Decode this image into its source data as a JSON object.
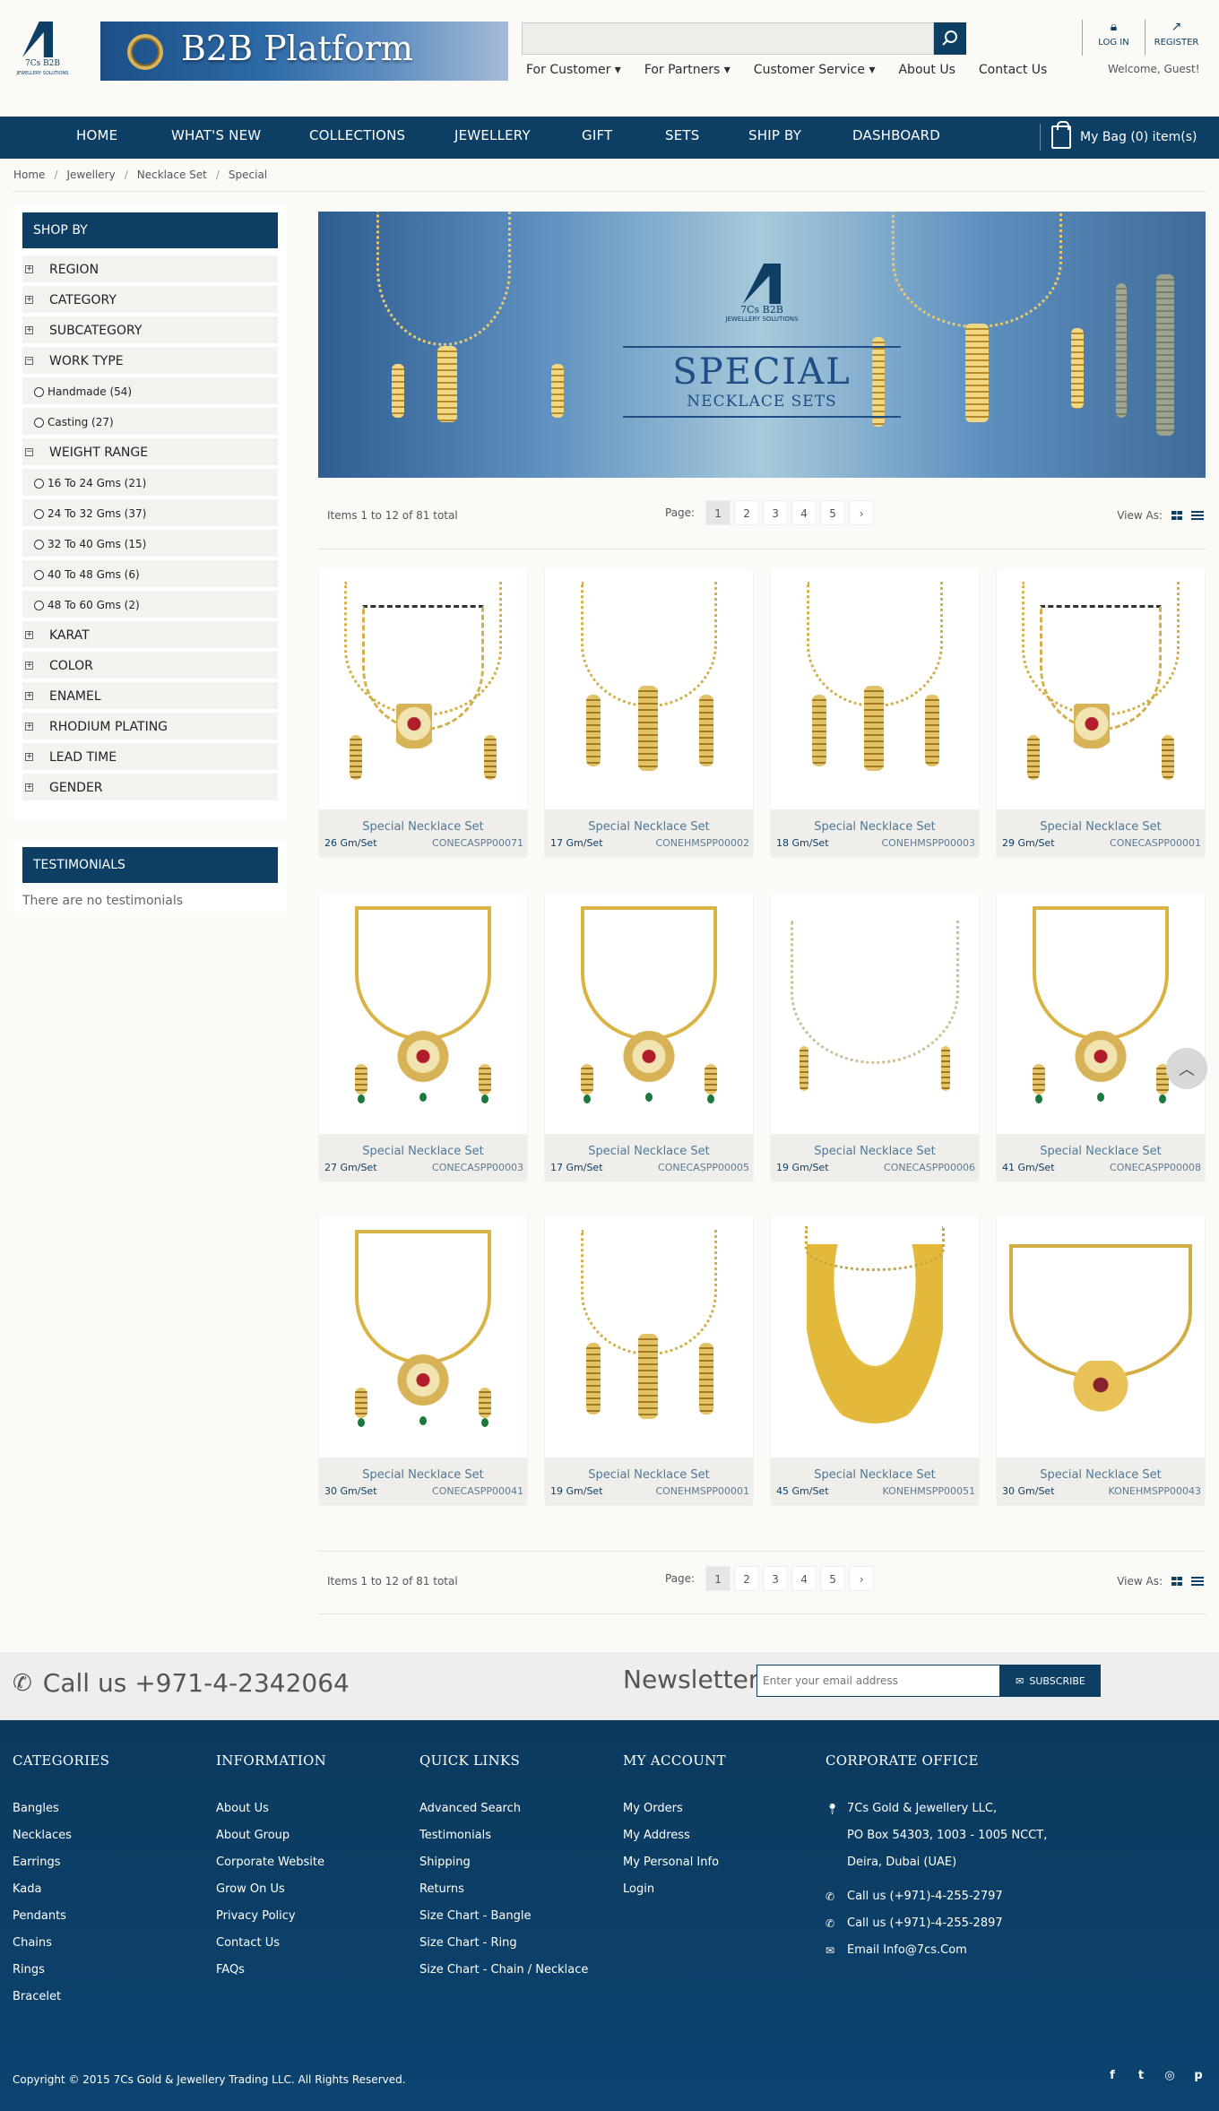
{
  "header": {
    "logo_text": "7Cs B2B",
    "logo_sub": "JEWELLERY SOLUTIONS",
    "banner_text": "B2B Platform",
    "search_placeholder": "",
    "top_links": [
      "For Customer ▾",
      "For Partners ▾",
      "Customer Service ▾",
      "About Us",
      "Contact Us"
    ],
    "login_label": "LOG IN",
    "register_label": "REGISTER",
    "welcome": "Welcome, Guest!"
  },
  "nav": {
    "items": [
      "HOME",
      "WHAT'S NEW",
      "COLLECTIONS",
      "JEWELLERY",
      "GIFT",
      "SETS",
      "SHIP BY",
      "DASHBOARD"
    ],
    "bag": "My Bag (0) item(s)"
  },
  "breadcrumb": [
    "Home",
    "Jewellery",
    "Necklace Set",
    "Special"
  ],
  "sidebar": {
    "title": "SHOP BY",
    "rows": [
      {
        "type": "group",
        "label": "REGION",
        "sign": "+"
      },
      {
        "type": "group",
        "label": "CATEGORY",
        "sign": "+"
      },
      {
        "type": "group",
        "label": "SUBCATEGORY",
        "sign": "+"
      },
      {
        "type": "group",
        "label": "WORK TYPE",
        "sign": "−"
      },
      {
        "type": "option",
        "label": "Handmade (54)"
      },
      {
        "type": "option",
        "label": "Casting (27)"
      },
      {
        "type": "group",
        "label": "WEIGHT RANGE",
        "sign": "−"
      },
      {
        "type": "option",
        "label": "16 To 24 Gms (21)"
      },
      {
        "type": "option",
        "label": "24 To 32 Gms (37)"
      },
      {
        "type": "option",
        "label": "32 To 40 Gms (15)"
      },
      {
        "type": "option",
        "label": "40 To 48 Gms (6)"
      },
      {
        "type": "option",
        "label": "48 To 60 Gms (2)"
      },
      {
        "type": "group",
        "label": "KARAT",
        "sign": "+"
      },
      {
        "type": "group",
        "label": "COLOR",
        "sign": "+"
      },
      {
        "type": "group",
        "label": "ENAMEL",
        "sign": "+"
      },
      {
        "type": "group",
        "label": "RHODIUM PLATING",
        "sign": "+"
      },
      {
        "type": "group",
        "label": "LEAD TIME",
        "sign": "+"
      },
      {
        "type": "group",
        "label": "GENDER",
        "sign": "+"
      }
    ]
  },
  "testimonials": {
    "title": "TESTIMONIALS",
    "empty": "There are no testimonials"
  },
  "hero": {
    "logo_text": "7Cs B2B",
    "logo_sub": "JEWELLERY SOLUTIONS",
    "title": "SPECIAL",
    "subtitle": "NECKLACE SETS"
  },
  "toolbar": {
    "items_text": "Items 1 to 12 of 81 total",
    "page_label": "Page:",
    "pages": [
      "1",
      "2",
      "3",
      "4",
      "5"
    ],
    "current_page": "1",
    "next": "›",
    "view_as": "View As:"
  },
  "products": [
    {
      "name": "Special Necklace Set",
      "weight": "26 Gm/Set",
      "sku": "CONECASPP00071",
      "style": "double"
    },
    {
      "name": "Special Necklace Set",
      "weight": "17 Gm/Set",
      "sku": "CONEHMSPP00002",
      "style": "vchain"
    },
    {
      "name": "Special Necklace Set",
      "weight": "18 Gm/Set",
      "sku": "CONEHMSPP00003",
      "style": "vchain"
    },
    {
      "name": "Special Necklace Set",
      "weight": "29 Gm/Set",
      "sku": "CONECASPP00001",
      "style": "double"
    },
    {
      "name": "Special Necklace Set",
      "weight": "27 Gm/Set",
      "sku": "CONECASPP00003",
      "style": "pendant"
    },
    {
      "name": "Special Necklace Set",
      "weight": "17 Gm/Set",
      "sku": "CONECASPP00005",
      "style": "pendant"
    },
    {
      "name": "Special Necklace Set",
      "weight": "19 Gm/Set",
      "sku": "CONECASPP00006",
      "style": "stone"
    },
    {
      "name": "Special Necklace Set",
      "weight": "41 Gm/Set",
      "sku": "CONECASPP00008",
      "style": "pendant"
    },
    {
      "name": "Special Necklace Set",
      "weight": "30 Gm/Set",
      "sku": "CONECASPP00041",
      "style": "pendant"
    },
    {
      "name": "Special Necklace Set",
      "weight": "19 Gm/Set",
      "sku": "CONEHMSPP00001",
      "style": "vchain"
    },
    {
      "name": "Special Necklace Set",
      "weight": "45 Gm/Set",
      "sku": "KONEHMSPP00051",
      "style": "collar"
    },
    {
      "name": "Special Necklace Set",
      "weight": "30 Gm/Set",
      "sku": "KONEHMSPP00043",
      "style": "collar2"
    }
  ],
  "callbar": {
    "phone": "Call us +971-4-2342064",
    "newsletter_label": "Newsletter",
    "email_placeholder": "Enter your email address",
    "subscribe": "SUBSCRIBE"
  },
  "footer": {
    "categories": {
      "title": "CATEGORIES",
      "links": [
        "Bangles",
        "Necklaces",
        "Earrings",
        "Kada",
        "Pendants",
        "Chains",
        "Rings",
        "Bracelet"
      ]
    },
    "information": {
      "title": "INFORMATION",
      "links": [
        "About Us",
        "About Group",
        "Corporate Website",
        "Grow On Us",
        "Privacy Policy",
        "Contact Us",
        "FAQs"
      ]
    },
    "quick_links": {
      "title": "QUICK LINKS",
      "links": [
        "Advanced Search",
        "Testimonials",
        "Shipping",
        "Returns",
        "Size Chart - Bangle",
        "Size Chart - Ring",
        "Size Chart - Chain / Necklace"
      ]
    },
    "my_account": {
      "title": "MY ACCOUNT",
      "links": [
        "My Orders",
        "My Address",
        "My Personal Info",
        "Login"
      ]
    },
    "corporate": {
      "title": "CORPORATE OFFICE",
      "address1": "7Cs Gold & Jewellery LLC,",
      "address2": "PO Box 54303, 1003 - 1005 NCCT,",
      "address3": "Deira, Dubai (UAE)",
      "phone1": "Call us (+971)-4-255-2797",
      "phone2": "Call us (+971)-4-255-2897",
      "email": "Email Info@7cs.Com"
    },
    "copyright": "Copyright © 2015 7Cs Gold & Jewellery Trading LLC. All Rights Reserved."
  },
  "colors": {
    "primary": "#0d3e64",
    "gold": "#d4b04c",
    "page_bg": "#fbfaf6"
  }
}
